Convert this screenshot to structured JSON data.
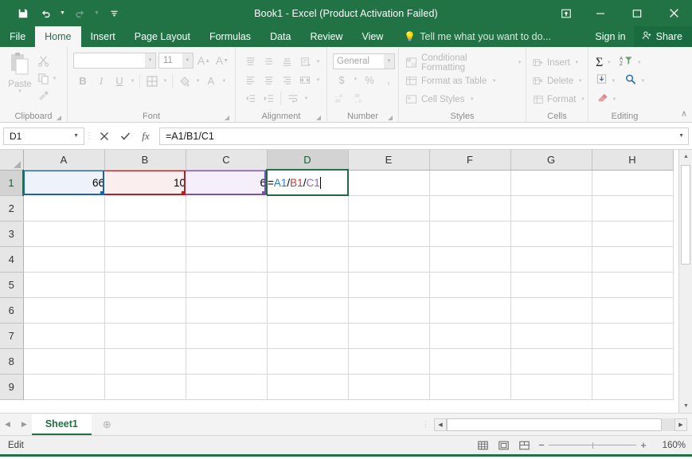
{
  "titlebar": {
    "quick_access": [
      {
        "name": "save",
        "glyph": "ὋE",
        "disabled": false
      },
      {
        "name": "undo",
        "glyph": "↶",
        "disabled": false
      },
      {
        "name": "redo",
        "glyph": "↷",
        "disabled": true
      },
      {
        "name": "customize-qat",
        "glyph": "☰",
        "disabled": false
      }
    ],
    "title": "Book1 - Excel (Product Activation Failed)",
    "ribbon_display_options": "⬚",
    "minimize": "─",
    "maximize": "☐",
    "close": "✕"
  },
  "ribbon_tabs": {
    "items": [
      "File",
      "Home",
      "Insert",
      "Page Layout",
      "Formulas",
      "Data",
      "Review",
      "View"
    ],
    "active": "Home",
    "tell_me": "Tell me what you want to do...",
    "sign_in": "Sign in",
    "share": "Share"
  },
  "ribbon": {
    "clipboard": {
      "label": "Clipboard",
      "paste": "Paste",
      "cut": "Cut",
      "copy": "Copy",
      "format_painter": "Format Painter"
    },
    "font": {
      "label": "Font",
      "font_name": "",
      "font_name_placeholder": "",
      "font_size": "11",
      "grow_font": "A",
      "shrink_font": "A",
      "bold": "B",
      "italic": "I",
      "underline": "U",
      "borders": "▦",
      "fill_color": "A",
      "font_color": "A"
    },
    "alignment": {
      "label": "Alignment"
    },
    "number": {
      "label": "Number",
      "format": "General",
      "accounting": "$",
      "percent": "%",
      "comma": ","
    },
    "styles": {
      "label": "Styles",
      "conditional_formatting": "Conditional Formatting",
      "format_as_table": "Format as Table",
      "cell_styles": "Cell Styles"
    },
    "cells": {
      "label": "Cells",
      "insert": "Insert",
      "delete": "Delete",
      "format": "Format"
    },
    "editing": {
      "label": "Editing",
      "autosum": "Σ",
      "fill": "↓",
      "clear": "⌫",
      "sort_filter": "AZ",
      "find_select": "⚲"
    },
    "collapse_ribbon": "∧"
  },
  "formula_bar": {
    "name_box": "D1",
    "name_box_caret": "▾",
    "cancel": "✕",
    "enter": "✓",
    "insert_function": "fx",
    "formula": "=A1/B1/C1",
    "expand_caret": "▾"
  },
  "grid": {
    "columns": [
      "A",
      "B",
      "C",
      "D",
      "E",
      "F",
      "G",
      "H"
    ],
    "selected_column": "D",
    "rows": [
      "1",
      "2",
      "3",
      "4",
      "5",
      "6",
      "7",
      "8",
      "9"
    ],
    "selected_row": "1",
    "cells": {
      "A1": "66",
      "B1": "10",
      "C1": "6"
    },
    "editing_cell": "D1",
    "formula_tokens": [
      {
        "text": "=",
        "color_role": "operator"
      },
      {
        "text": "A1",
        "color_role": "ref-a"
      },
      {
        "text": "/",
        "color_role": "operator"
      },
      {
        "text": "B1",
        "color_role": "ref-b"
      },
      {
        "text": "/",
        "color_role": "operator"
      },
      {
        "text": "C1",
        "color_role": "ref-c"
      }
    ],
    "reference_colors": {
      "ref-a": "#1f5fad",
      "ref-b": "#b02025",
      "ref-c": "#7b52ab",
      "editing_border": "#1c6b44"
    },
    "scroll_up": "▲",
    "scroll_down": "▼"
  },
  "sheet_tabs": {
    "prev": "◀",
    "next": "▶",
    "sheets": [
      "Sheet1"
    ],
    "active_sheet": "Sheet1",
    "add_sheet": "⊕",
    "split_handle": "⋮",
    "hscroll_left": "◀",
    "hscroll_right": "▶"
  },
  "status_bar": {
    "mode": "Edit",
    "view_normal": "▦",
    "view_page_layout": "▤",
    "view_page_break": "▥",
    "zoom_out": "−",
    "zoom_in": "+",
    "zoom_level": "160%"
  },
  "theme": {
    "accent": "#217346",
    "titlebar_bg": "#217346",
    "ribbon_bg": "#f6f6f6"
  }
}
